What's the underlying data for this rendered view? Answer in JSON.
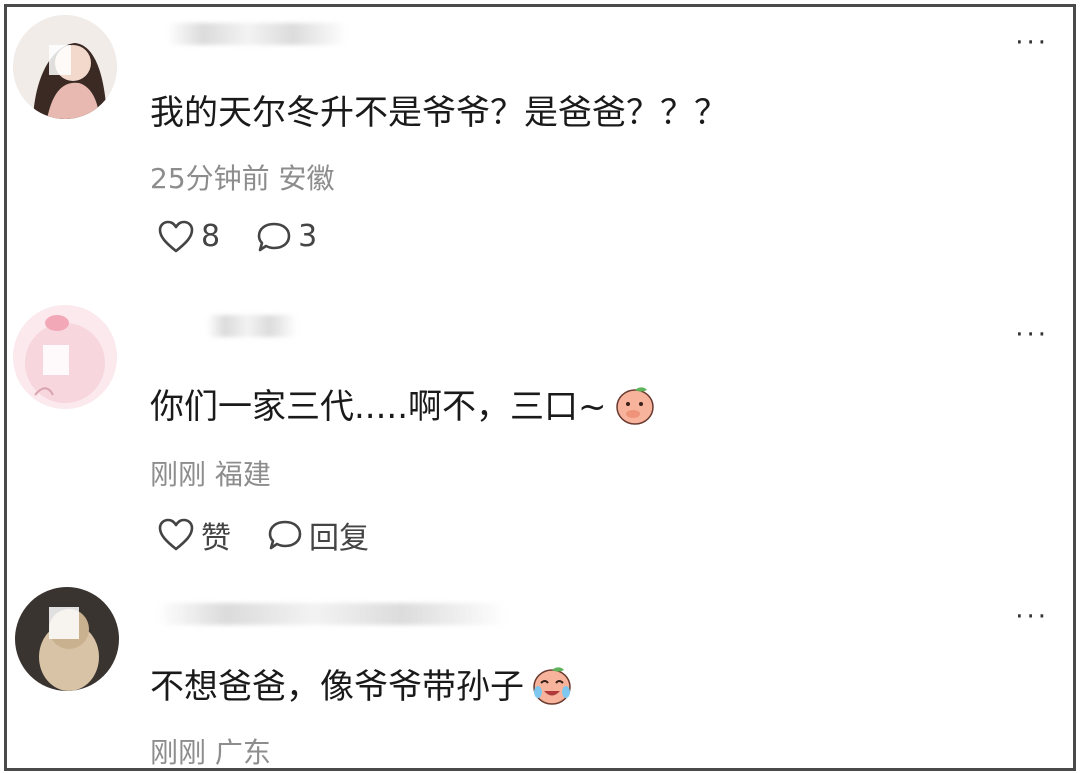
{
  "comments": [
    {
      "text": "我的天尔冬升不是爷爷？是爸爸？？？",
      "meta": "25分钟前 安徽",
      "like_label": "8",
      "reply_label": "3",
      "more_label": "···"
    },
    {
      "text": "你们一家三代.....啊不，三口~",
      "meta": "刚刚 福建",
      "like_label": "赞",
      "reply_label": "回复",
      "more_label": "···"
    },
    {
      "text": "不想爸爸，像爷爷带孙子",
      "meta": "刚刚 广东",
      "more_label": "···"
    }
  ],
  "icons": {
    "like": "heart-outline-icon",
    "reply": "speech-bubble-icon",
    "more": "ellipsis-icon",
    "emoji_1": "peach-face-cover-mouth-emoji",
    "emoji_2": "peach-face-crying-laughing-emoji"
  },
  "colors": {
    "text": "#1a1a1a",
    "meta": "#8d8d8d",
    "frame_border": "#4a4a4a"
  }
}
